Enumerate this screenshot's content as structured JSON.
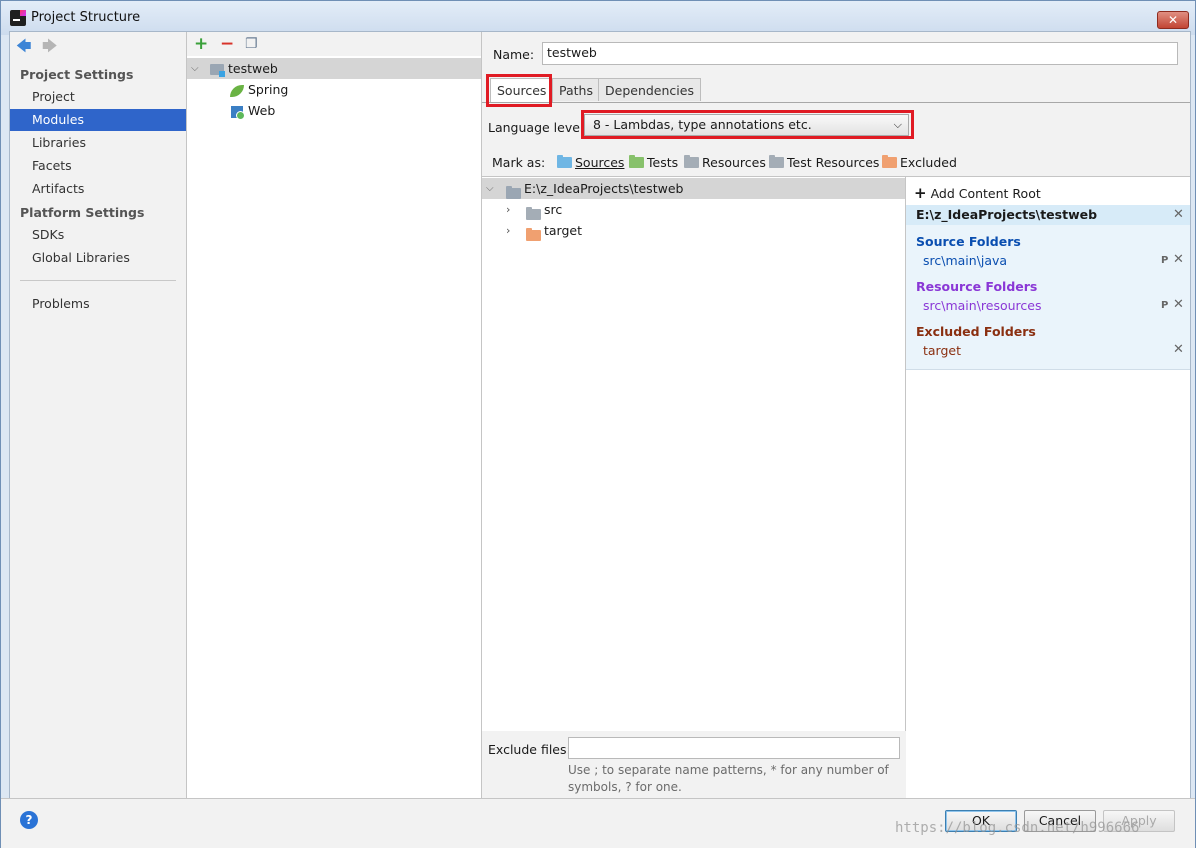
{
  "window": {
    "title": "Project Structure"
  },
  "nav": {
    "sections": [
      {
        "title": "Project Settings",
        "items": [
          "Project",
          "Modules",
          "Libraries",
          "Facets",
          "Artifacts"
        ]
      },
      {
        "title": "Platform Settings",
        "items": [
          "SDKs",
          "Global Libraries"
        ]
      }
    ],
    "problems": "Problems",
    "selected": "Modules"
  },
  "module_tree": {
    "root": "testweb",
    "children": [
      "Spring",
      "Web"
    ]
  },
  "module": {
    "name_label": "Name:",
    "name_value": "testweb",
    "tabs": [
      "Sources",
      "Paths",
      "Dependencies"
    ],
    "active_tab": "Sources",
    "language_level_label": "Language level:",
    "language_level_value": "8 - Lambdas, type annotations etc.",
    "mark_as_label": "Mark as:",
    "mark_as": [
      {
        "label": "Sources",
        "color": "#6fb6e4"
      },
      {
        "label": "Tests",
        "color": "#87c16b"
      },
      {
        "label": "Resources",
        "color": "#a4adb6"
      },
      {
        "label": "Test Resources",
        "color": "#a4adb6"
      },
      {
        "label": "Excluded",
        "color": "#f0a070"
      }
    ]
  },
  "content_tree": {
    "root": "E:\\z_IdeaProjects\\testweb",
    "children": [
      {
        "label": "src",
        "color": "#a4adb6"
      },
      {
        "label": "target",
        "color": "#f0a070"
      }
    ]
  },
  "roots_panel": {
    "add_label": "Add Content Root",
    "root_path": "E:\\z_IdeaProjects\\testweb",
    "source_title": "Source Folders",
    "source_item": "src\\main\\java",
    "resource_title": "Resource Folders",
    "resource_item": "src\\main\\resources",
    "excluded_title": "Excluded Folders",
    "excluded_item": "target",
    "colors": {
      "source": "#0a4eb0",
      "resource": "#8a37d6",
      "excluded": "#8a2f10"
    }
  },
  "exclude": {
    "label": "Exclude files:",
    "value": "",
    "hint": "Use ; to separate name patterns, * for any number of symbols, ? for one."
  },
  "buttons": {
    "ok": "OK",
    "cancel": "Cancel",
    "apply": "Apply"
  },
  "watermark": "https://blog.csdn.net/h996666"
}
